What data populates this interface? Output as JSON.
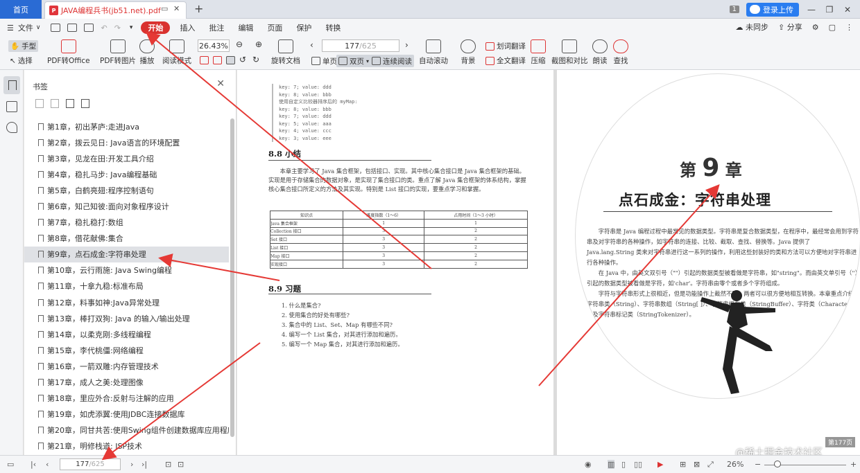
{
  "tabbar": {
    "home": "首页",
    "doc_tab_title": "JAVA编程兵书(jb51.net).pdf",
    "pdf_icon_text": "P",
    "add_tab": "+",
    "count_badge": "1",
    "login_label": "登录上传"
  },
  "menubar": {
    "file": "文件",
    "tabs": [
      "开始",
      "插入",
      "批注",
      "编辑",
      "页面",
      "保护",
      "转换"
    ],
    "active_tab": "开始",
    "right": {
      "sync": "未同步",
      "share": "分享"
    }
  },
  "ribbon": {
    "hand": "手型",
    "select": "选择",
    "pdf_to_office": "PDF转Office",
    "pdf_to_image": "PDF转图片",
    "play": "播放",
    "read_mode": "阅读模式",
    "zoom": "26.43%",
    "rotate": "旋转文档",
    "page_current": "177",
    "page_total": "/625",
    "single": "单页",
    "double": "双页",
    "continuous": "连续阅读",
    "auto_scroll": "自动滚动",
    "background": "背景",
    "word_translate": "划词翻译",
    "full_translate": "全文翻译",
    "compress": "压缩",
    "screenshot_compare": "截图和对比",
    "read_aloud": "朗读",
    "find": "查找"
  },
  "sidebar": {
    "title": "书签",
    "selected_index": 8,
    "items": [
      "第1章，初出茅庐:走进Java",
      "第2章，拨云见日: Java语言的环境配置",
      "第3章，见龙在田:开发工具介绍",
      "第4章，稳扎马步: Java编程基础",
      "第5章，白鹤亮翅:程序控制语句",
      "第6章，知己知彼:面向对象程序设计",
      "第7章，稳扎稳打:数组",
      "第8章，借花献佛:集合",
      "第9章，点石成金:字符串处理",
      "第10章，云行雨施: Java Swing编程",
      "第11章，十拿九稳:标准布局",
      "第12章，料事如神:Java异常处理",
      "第13章，棒打双狗: Java 的输入/输出处理",
      "第14章，以柔克刚:多线程编程",
      "第15章，李代桃僵:网络编程",
      "第16章，一箭双雕:内存管理技术",
      "第17章，成人之美:处理图像",
      "第18章，里应外合:反射与注解的应用",
      "第19章，如虎添翼:使用JDBC连接数据库",
      "第20章，同甘共苦:使用Swing组件创建数据库应用程序",
      "第21章，明修栈道: JSP技术"
    ]
  },
  "page_left": {
    "code_lines": [
      "key: 7; value: ddd",
      "key: 8; value: bbb",
      "使用自定义比较器排序后的 myMap:",
      "key: 8; value: bbb",
      "key: 7; value: ddd",
      "key: 5; value: aaa",
      "key: 4; value: ccc",
      "key: 3; value: eee"
    ],
    "section_8_8": "8.8   小结",
    "summary": "本章主要学习了 Java 集合框架，包括接口、实现。其中核心集合接口是 Java 集合框架的基础。实现是用于存储集合的数据对象，是实现了集合接口的类。重点了解 Java 集合框架的体系结构，掌握核心集合接口所定义的方法及其实现。特别是 List 接口的实现，要重点学习和掌握。",
    "table": {
      "headers": [
        "知识点",
        "难度指数（1～6）",
        "占用时间（1～3 小时）"
      ],
      "rows": [
        [
          "Java 集合框架",
          "1",
          "1"
        ],
        [
          "Collection 接口",
          "3",
          "2"
        ],
        [
          "Set 接口",
          "3",
          "2"
        ],
        [
          "List 接口",
          "3",
          "2"
        ],
        [
          "Map 接口",
          "3",
          "2"
        ],
        [
          "实现接口",
          "3",
          "2"
        ]
      ]
    },
    "section_8_9": "8.9   习题",
    "exercises": [
      "1.  什么是集合?",
      "2.  使用集合的好处有哪些?",
      "3.  集合中的 List、Set、Map 有哪些不同?",
      "4.  编写一个 List 集合，对其进行添加和遍历。",
      "5.  编写一个 Map 集合，对其进行添加和遍历。"
    ]
  },
  "page_right": {
    "chapter_prefix": "第",
    "chapter_number": "9",
    "chapter_suffix": "章",
    "chapter_title": "点石成金：字符串处理",
    "paragraphs": [
      "字符串是 Java 编程过程中最常见的数据类型。字符串是复合数据类型，在程序中，最经常会用到字符串及对字符串的各种操作，如字符串的连接、比较、截取、查找、替换等。Java 提供了 Java.lang.String 类来对字符串进行这一系列的操作，利用这些封装好的类和方法可以方便地对字符串进行各种操作。",
      "在 Java 中，由英文双引号（\"\"）引起的数据类型被看做是字符串，如\"string\"。而由英文单引号（''）引起的数据类型被看做是字符，如'char'。字符串由零个或者多个字符组成。",
      "字符与字符串形式上很相近，但是功能操作上截然不同。两者可以很方便地相互转换。本章重点介绍字符串类（String）、字符串数组（String[ ]）、字符串缓存类（StringBuffer）、字符类（Character）以及字符串标记类（StringTokenizer）。"
    ],
    "page_label": "第177页"
  },
  "statusbar": {
    "page_current": "177",
    "page_total": "/625",
    "zoom": "26%"
  },
  "watermark": "@稀土掘金技术社区",
  "colors": {
    "accent": "#2a6bd4",
    "active_tab": "#d9322f",
    "annotation_arrow": "#e53935"
  }
}
